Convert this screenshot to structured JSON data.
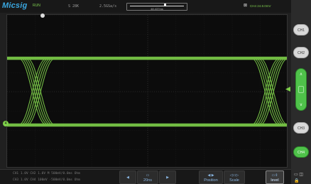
{
  "app": {
    "brand": "Micsig",
    "run_state": "RUN"
  },
  "topbar": {
    "sample_depth": "S   28K",
    "sample_rate": "2.5GSa/s",
    "time_window_label": "48.437ms",
    "trigger_info": "CH4 24.8.0mV"
  },
  "right_panel": {
    "ch_buttons": [
      "CH1",
      "CH2",
      "CH3",
      "CH4"
    ],
    "rocker_up": "∧",
    "rocker_down": "∨",
    "active_color": "#4fc24a"
  },
  "bottom_bar": {
    "info_row1": "CH1 1.0V   CH2 1.0V   M 500mV/0.0ms   Ohm",
    "info_row2": "CH3 1.0V   CH4 100mV   ·500mV/0.0ms   Ohm",
    "timebase": "20ns",
    "position_label": "Position",
    "scale_label": "Scale",
    "level_label": "level"
  },
  "waveform": {
    "trace_color": "#7ed04a",
    "high_level_label": "4",
    "ground_label": "4"
  }
}
